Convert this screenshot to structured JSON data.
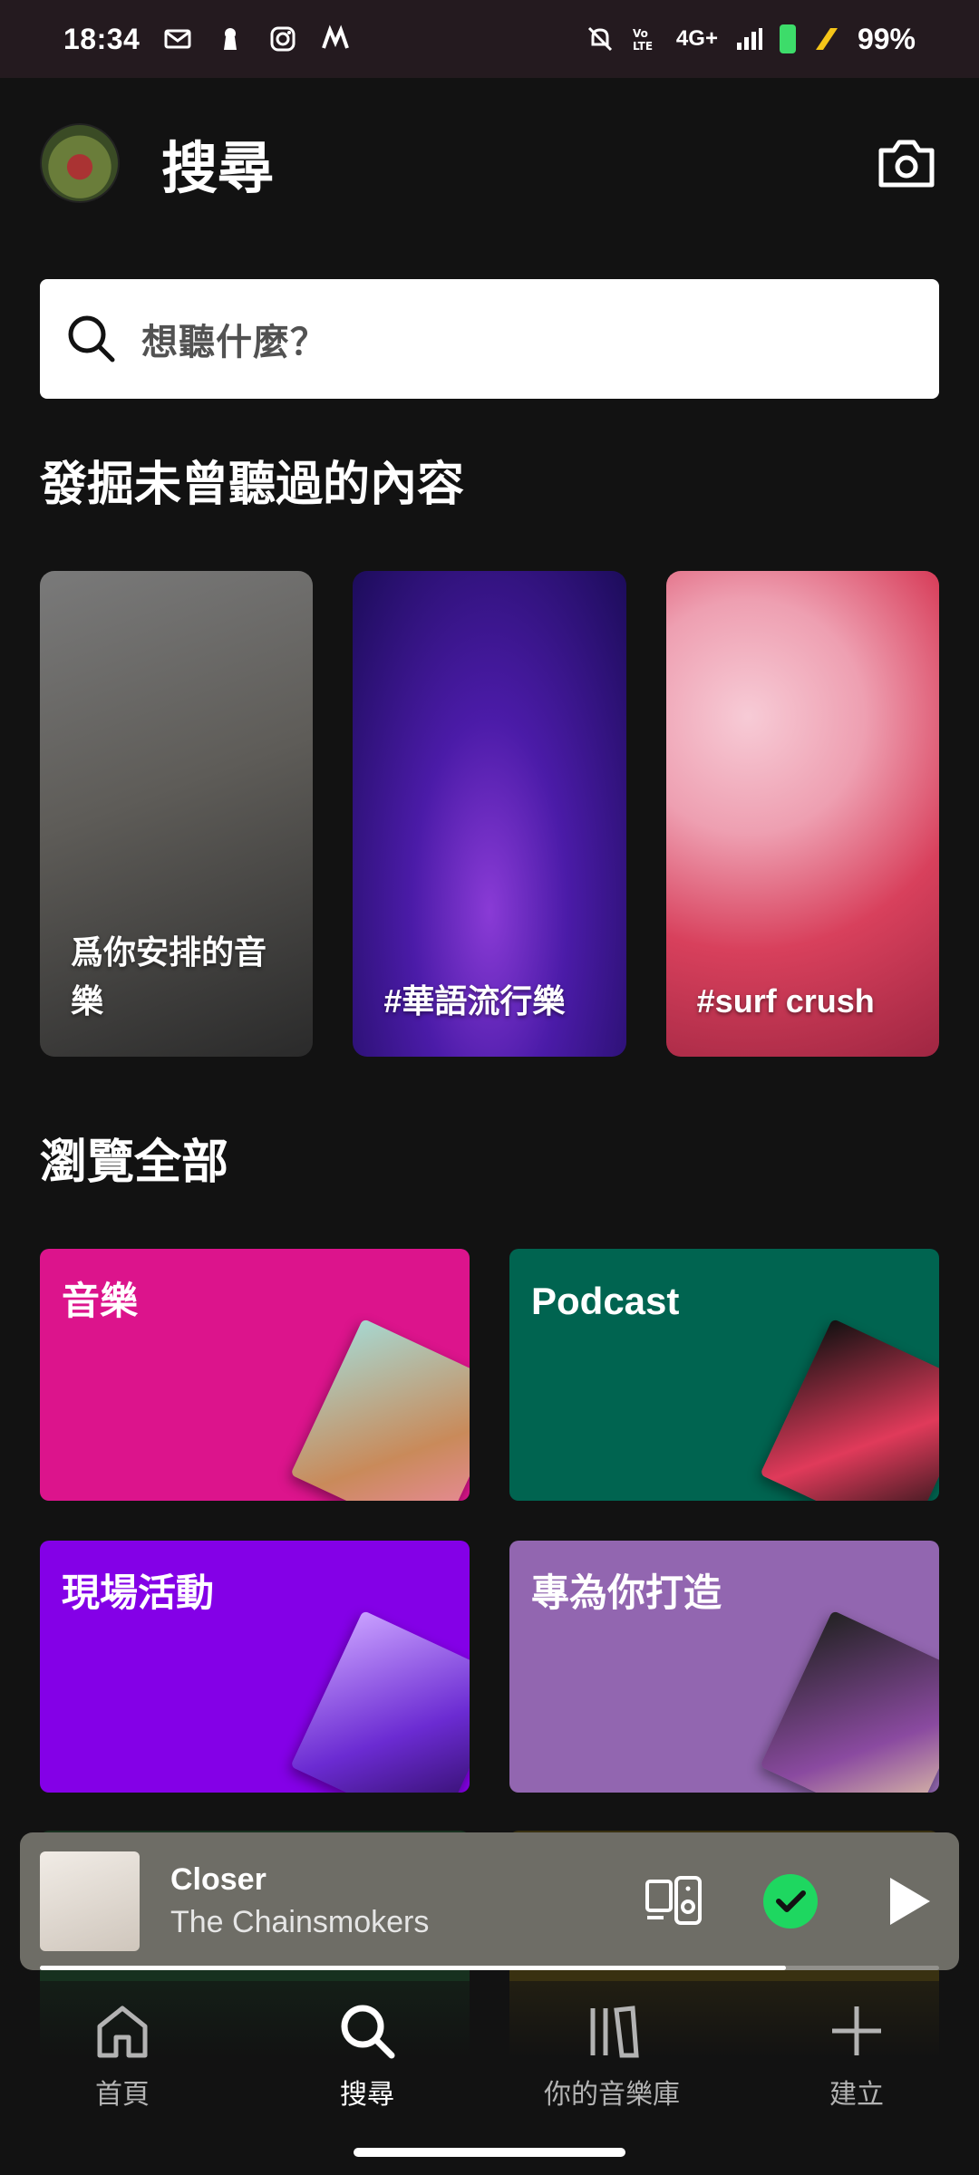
{
  "status_bar": {
    "time": "18:34",
    "network": "4G+",
    "battery": "99%",
    "left_icons": [
      "mail-icon",
      "keyhole-icon",
      "instagram-icon",
      "app-icon"
    ],
    "right_icons": [
      "mute-icon",
      "volte-icon",
      "signal-icon",
      "battery-icon",
      "charging-icon"
    ]
  },
  "header": {
    "title": "搜尋"
  },
  "search": {
    "placeholder": "想聽什麼？"
  },
  "discover": {
    "title": "發掘未曾聽過的內容",
    "cards": [
      {
        "label": "爲你安排的音樂"
      },
      {
        "label": "#華語流行樂"
      },
      {
        "label": "#surf crush"
      }
    ]
  },
  "browse": {
    "title": "瀏覽全部",
    "cards": [
      {
        "label": "音樂",
        "color": "#dc148c"
      },
      {
        "label": "Podcast",
        "color": "#006450"
      },
      {
        "label": "現場活動",
        "color": "#8400e7"
      },
      {
        "label": "專為你打造",
        "color": "#9266b0"
      }
    ]
  },
  "player": {
    "title": "Closer",
    "artist": "The Chainsmokers",
    "progress": 0.83,
    "accent": "#1ed760"
  },
  "nav": {
    "items": [
      {
        "label": "首頁",
        "icon": "home-icon",
        "active": false
      },
      {
        "label": "搜尋",
        "icon": "search-icon",
        "active": true
      },
      {
        "label": "你的音樂庫",
        "icon": "library-icon",
        "active": false
      },
      {
        "label": "建立",
        "icon": "plus-icon",
        "active": false
      }
    ]
  }
}
